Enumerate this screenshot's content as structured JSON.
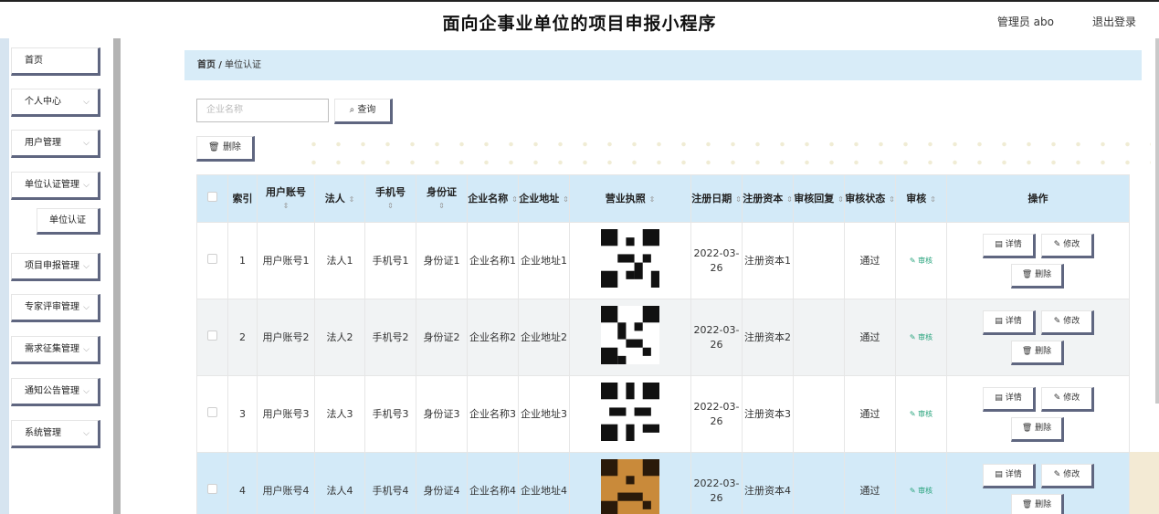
{
  "header": {
    "title": "面向企事业单位的项目申报小程序",
    "user": "管理员 abo",
    "logout": "退出登录"
  },
  "sidebar": {
    "items": [
      {
        "label": "首页",
        "chev": false
      },
      {
        "label": "个人中心",
        "chev": true
      },
      {
        "label": "用户管理",
        "chev": true
      },
      {
        "label": "单位认证管理",
        "chev": true
      },
      {
        "label": "单位认证",
        "chev": false,
        "sub": true
      },
      {
        "label": "项目申报管理",
        "chev": true
      },
      {
        "label": "专家评审管理",
        "chev": true
      },
      {
        "label": "需求征集管理",
        "chev": true
      },
      {
        "label": "通知公告管理",
        "chev": true
      },
      {
        "label": "系统管理",
        "chev": true
      }
    ]
  },
  "breadcrumb": {
    "home": "首页",
    "sep": "/",
    "current": "单位认证"
  },
  "search": {
    "placeholder": "企业名称",
    "query_label": "查询",
    "query_icon": "search-icon"
  },
  "toolbar": {
    "delete_label": "删除",
    "delete_icon": "trash-icon"
  },
  "table": {
    "headers": [
      "索引",
      "用户账号",
      "法人",
      "手机号",
      "身份证",
      "企业名称",
      "企业地址",
      "营业执照",
      "注册日期",
      "注册资本",
      "审核回复",
      "审核状态",
      "审核",
      "操作"
    ],
    "rows": [
      {
        "idx": "1",
        "account": "用户账号1",
        "legal": "法人1",
        "phone": "手机号1",
        "idcard": "身份证1",
        "company": "企业名称1",
        "address": "企业地址1",
        "date": "2022-03-26",
        "capital": "注册资本1",
        "reply": "",
        "status": "通过",
        "audit": "审核"
      },
      {
        "idx": "2",
        "account": "用户账号2",
        "legal": "法人2",
        "phone": "手机号2",
        "idcard": "身份证2",
        "company": "企业名称2",
        "address": "企业地址2",
        "date": "2022-03-26",
        "capital": "注册资本2",
        "reply": "",
        "status": "通过",
        "audit": "审核"
      },
      {
        "idx": "3",
        "account": "用户账号3",
        "legal": "法人3",
        "phone": "手机号3",
        "idcard": "身份证3",
        "company": "企业名称3",
        "address": "企业地址3",
        "date": "2022-03-26",
        "capital": "注册资本3",
        "reply": "",
        "status": "通过",
        "audit": "审核"
      },
      {
        "idx": "4",
        "account": "用户账号4",
        "legal": "法人4",
        "phone": "手机号4",
        "idcard": "身份证4",
        "company": "企业名称4",
        "address": "企业地址4",
        "date": "2022-03-26",
        "capital": "注册资本4",
        "reply": "",
        "status": "通过",
        "audit": "审核"
      }
    ],
    "actions": {
      "detail": "详情",
      "edit": "修改",
      "delete": "删除"
    }
  },
  "colors": {
    "accent_border": "#5f6680",
    "header_bg": "#d3eaf8",
    "audit_green": "#27a37c"
  }
}
